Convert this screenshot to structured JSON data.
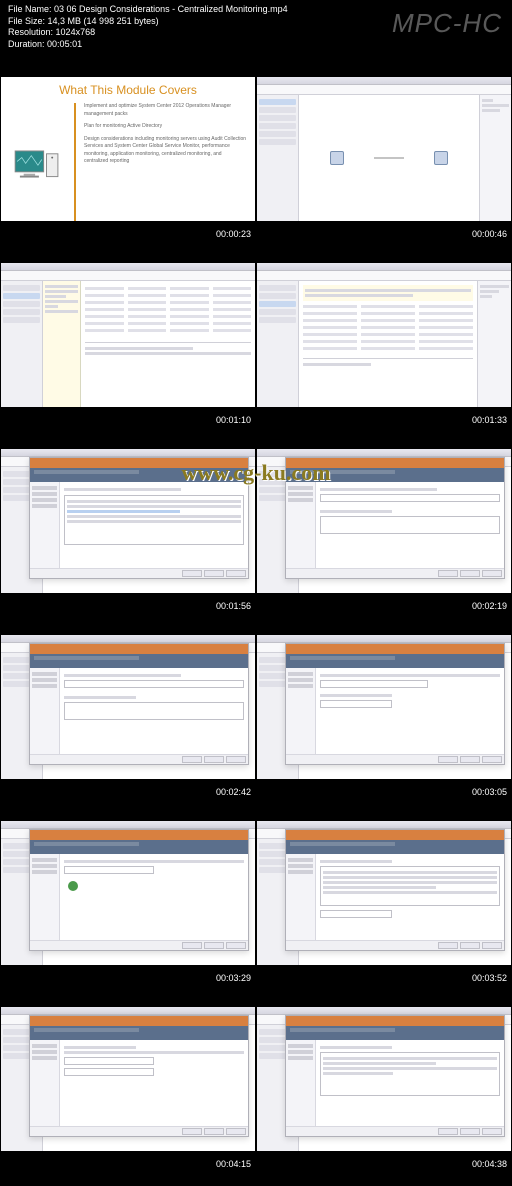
{
  "header": {
    "filename_label": "File Name:",
    "filename": "03 06 Design Considerations - Centralized Monitoring.mp4",
    "filesize_label": "File Size:",
    "filesize": "14,3 MB (14 998 251 bytes)",
    "resolution_label": "Resolution:",
    "resolution": "1024x768",
    "duration_label": "Duration:",
    "duration": "00:05:01",
    "logo": "MPC-HC"
  },
  "watermark": "www.cg-ku.com",
  "thumbs": [
    {
      "time": "00:00:23",
      "kind": "slide",
      "title": "What This Module Covers",
      "bullets": [
        "Implement and optimize System Center 2012 Operations Manager management packs",
        "Plan for monitoring Active Directory",
        "Design considerations including monitoring servers using Audit Collection Services and System Center Global Service Monitor, performance monitoring, application monitoring, centralized monitoring, and centralized reporting"
      ]
    },
    {
      "time": "00:00:46",
      "kind": "app-graph"
    },
    {
      "time": "00:01:10",
      "kind": "app-list"
    },
    {
      "time": "00:01:33",
      "kind": "app-list"
    },
    {
      "time": "00:01:56",
      "kind": "app-dialog"
    },
    {
      "time": "00:02:19",
      "kind": "app-dialog-input"
    },
    {
      "time": "00:02:42",
      "kind": "app-dialog-input"
    },
    {
      "time": "00:03:05",
      "kind": "app-dialog-input"
    },
    {
      "time": "00:03:29",
      "kind": "app-dialog-check"
    },
    {
      "time": "00:03:52",
      "kind": "app-dialog-list"
    },
    {
      "time": "00:04:15",
      "kind": "app-dialog-input"
    },
    {
      "time": "00:04:38",
      "kind": "app-dialog-list"
    }
  ]
}
